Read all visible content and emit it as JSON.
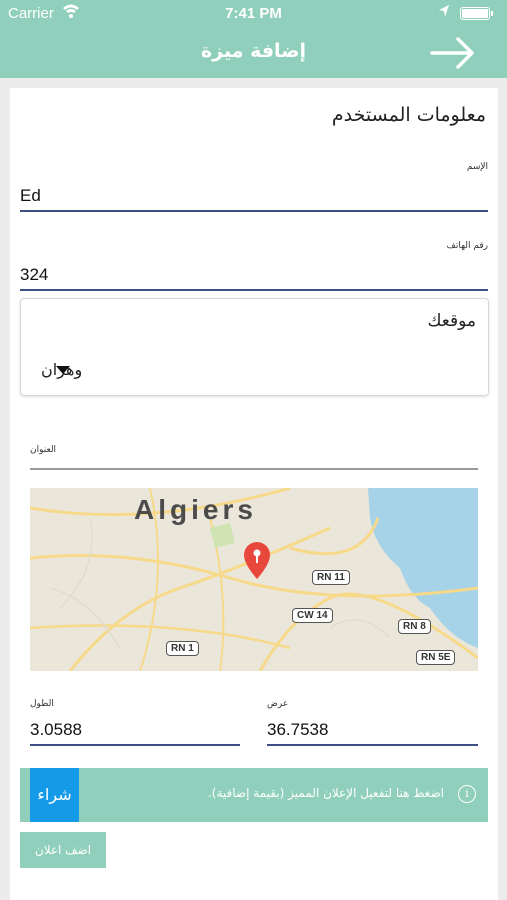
{
  "status_bar": {
    "carrier": "Carrier",
    "time": "7:41 PM",
    "icons": [
      "wifi-icon",
      "location-arrow-icon",
      "battery-icon"
    ]
  },
  "nav": {
    "title": "إضافة ميزة",
    "back_icon": "arrow-right-icon"
  },
  "form": {
    "section_title": "معلومات المستخدم",
    "name": {
      "label": "الإسم",
      "value": "Ed"
    },
    "phone": {
      "label": "رقم الهاتف",
      "value": "324"
    },
    "location": {
      "title": "موقعك",
      "selected": "وهران"
    },
    "address": {
      "label": "العنوان",
      "value": ""
    },
    "map": {
      "city_label": "Algiers",
      "roads": [
        "RN 11",
        "CW 14",
        "RN 8",
        "RN 1",
        "RN 5E"
      ],
      "colors": {
        "land": "#ebe6da",
        "water": "#a7d3e8",
        "road": "#f7d98a",
        "pin": "#e8473c"
      }
    },
    "longitude": {
      "label": "الطول",
      "value": "3.0588"
    },
    "latitude": {
      "label": "عرض",
      "value": "36.7538"
    }
  },
  "promo": {
    "buy_label": "شراء",
    "message": "اضغط هنا لتفعيل الإعلان المميز (بقيمة إضافية).",
    "info_icon": "i"
  },
  "add_button": "اضف اعلان",
  "colors": {
    "accent": "#8fcfbb",
    "buy": "#159ae8",
    "underline": "#3f4f82"
  }
}
